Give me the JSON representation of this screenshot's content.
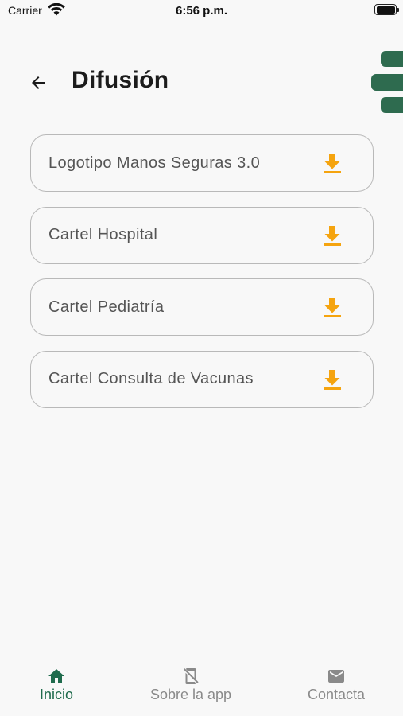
{
  "status_bar": {
    "carrier": "Carrier",
    "time": "6:56 p.m."
  },
  "header": {
    "title": "Difusión",
    "back_icon": "arrow-left-icon"
  },
  "files": [
    {
      "label": "Logotipo Manos Seguras 3.0",
      "icon": "download-icon"
    },
    {
      "label": "Cartel Hospital",
      "icon": "download-icon"
    },
    {
      "label": "Cartel Pediatría",
      "icon": "download-icon"
    },
    {
      "label": "Cartel Consulta de Vacunas",
      "icon": "download-icon"
    }
  ],
  "nav": {
    "items": [
      {
        "label": "Inicio",
        "icon": "home-icon",
        "active": true
      },
      {
        "label": "Sobre la app",
        "icon": "phone-off-icon",
        "active": false
      },
      {
        "label": "Contacta",
        "icon": "mail-icon",
        "active": false
      }
    ]
  },
  "colors": {
    "accent_green": "#1f6b4c",
    "logo_green": "#2e6b4f",
    "download_orange": "#f5a40f",
    "inactive_gray": "#8a8a8a"
  }
}
